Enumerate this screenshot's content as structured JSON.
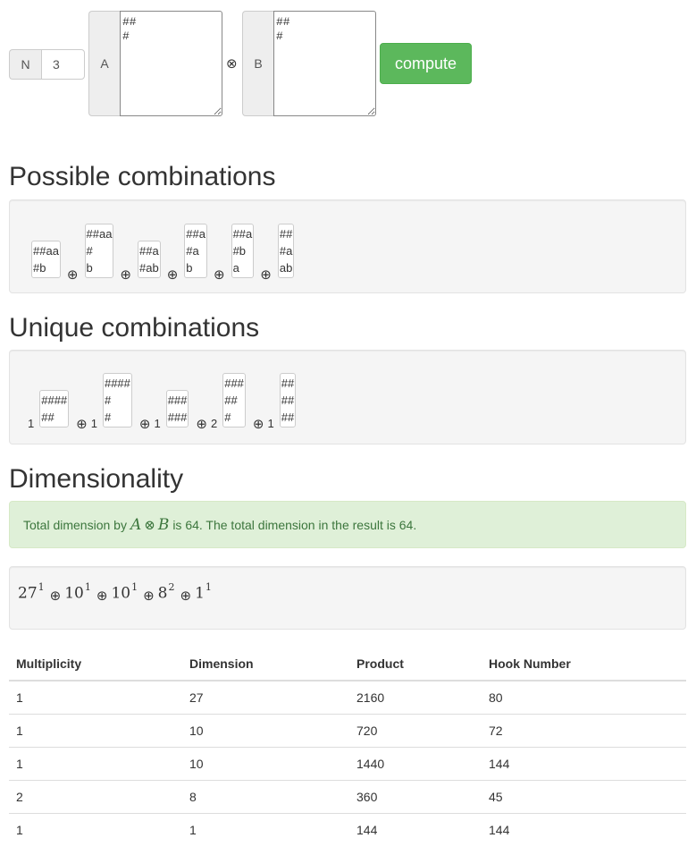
{
  "form": {
    "n_label": "N",
    "n_value": "3",
    "a_label": "A",
    "a_value": "##\n#",
    "tensor_symbol": "⊗",
    "b_label": "B",
    "b_value": "##\n#",
    "compute_label": "compute"
  },
  "possible": {
    "heading": "Possible combinations",
    "oplus": "⊕",
    "items": [
      {
        "lines": [
          "##aa",
          "#b"
        ]
      },
      {
        "lines": [
          "##aa",
          "#",
          "b"
        ]
      },
      {
        "lines": [
          "##a",
          "#ab"
        ]
      },
      {
        "lines": [
          "##a",
          "#a",
          "b"
        ]
      },
      {
        "lines": [
          "##a",
          "#b",
          "a"
        ]
      },
      {
        "lines": [
          "##",
          "#a",
          "ab"
        ]
      }
    ]
  },
  "unique": {
    "heading": "Unique combinations",
    "oplus": "⊕",
    "items": [
      {
        "multiplicity": "1",
        "lines": [
          "####",
          "##"
        ]
      },
      {
        "multiplicity": "1",
        "lines": [
          "####",
          "#",
          "#"
        ]
      },
      {
        "multiplicity": "1",
        "lines": [
          "###",
          "###"
        ]
      },
      {
        "multiplicity": "2",
        "lines": [
          "###",
          "##",
          "#"
        ]
      },
      {
        "multiplicity": "1",
        "lines": [
          "##",
          "##",
          "##"
        ]
      }
    ]
  },
  "dimensionality": {
    "heading": "Dimensionality",
    "alert_prefix": "Total dimension by",
    "alert_math_a": "A",
    "alert_math_op": "⊗",
    "alert_math_b": "B",
    "alert_middle": "is 64. The total dimension in the result is 64.",
    "sum_terms": [
      {
        "base": "27",
        "exp": "1"
      },
      {
        "base": "10",
        "exp": "1"
      },
      {
        "base": "10",
        "exp": "1"
      },
      {
        "base": "8",
        "exp": "2"
      },
      {
        "base": "1",
        "exp": "1"
      }
    ],
    "sum_oplus": "⊕"
  },
  "table": {
    "headers": [
      "Multiplicity",
      "Dimension",
      "Product",
      "Hook Number"
    ],
    "rows": [
      [
        "1",
        "27",
        "2160",
        "80"
      ],
      [
        "1",
        "10",
        "720",
        "72"
      ],
      [
        "1",
        "10",
        "1440",
        "144"
      ],
      [
        "2",
        "8",
        "360",
        "45"
      ],
      [
        "1",
        "1",
        "144",
        "144"
      ]
    ]
  }
}
